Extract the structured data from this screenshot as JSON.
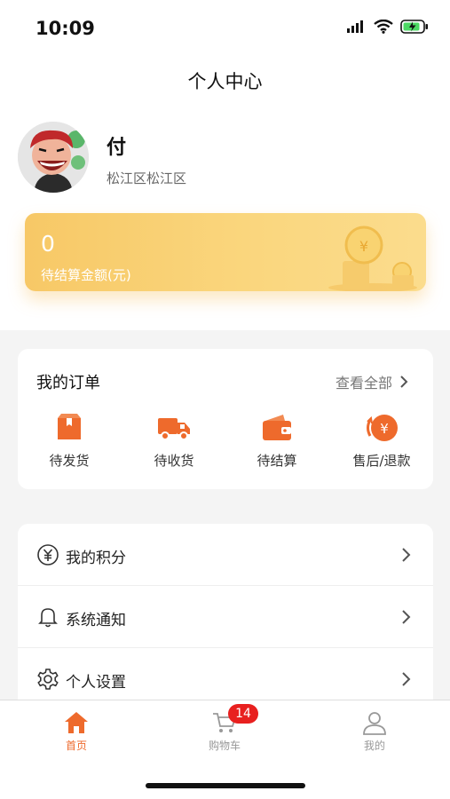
{
  "status_bar": {
    "time": "10:09"
  },
  "header": {
    "title": "个人中心"
  },
  "profile": {
    "name": "付",
    "region": "松江区松江区"
  },
  "earnings": {
    "amount": "0",
    "label": "待结算金额(元)"
  },
  "orders": {
    "title": "我的订单",
    "view_all": "查看全部",
    "items": [
      {
        "label": "待发货",
        "icon": "package-icon"
      },
      {
        "label": "待收货",
        "icon": "truck-icon"
      },
      {
        "label": "待结算",
        "icon": "wallet-icon"
      },
      {
        "label": "售后/退款",
        "icon": "yen-refund-icon"
      }
    ]
  },
  "menu": [
    {
      "label": "我的积分",
      "icon": "yen-circle-icon"
    },
    {
      "label": "系统通知",
      "icon": "bell-icon"
    },
    {
      "label": "个人设置",
      "icon": "gear-icon"
    }
  ],
  "tabbar": {
    "items": [
      {
        "label": "首页",
        "icon": "home-icon",
        "active": true
      },
      {
        "label": "购物车",
        "icon": "cart-icon",
        "badge": "14"
      },
      {
        "label": "我的",
        "icon": "user-icon"
      }
    ]
  },
  "colors": {
    "accent": "#EE6A2C",
    "badge": "#E8201F",
    "card_gold": "#F7C866"
  }
}
